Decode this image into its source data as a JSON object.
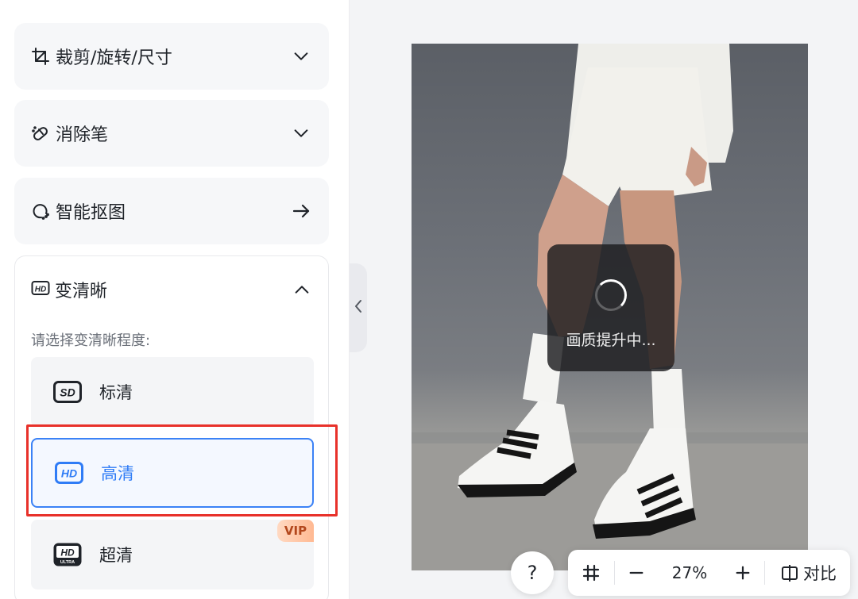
{
  "sidebar": {
    "crop": {
      "label": "裁剪/旋转/尺寸",
      "icon": "crop-icon",
      "action_icon": "chevron-down-icon"
    },
    "eraser": {
      "label": "消除笔",
      "icon": "eraser-icon",
      "action_icon": "chevron-down-icon"
    },
    "cutout": {
      "label": "智能抠图",
      "icon": "cutout-icon",
      "action_icon": "arrow-right-icon"
    },
    "enhance": {
      "label": "变清晰",
      "icon": "hd-icon",
      "action_icon": "chevron-up-icon",
      "prompt": "请选择变清晰程度:",
      "options": [
        {
          "label": "标清",
          "icon": "sd-badge-icon",
          "icon_text": "SD"
        },
        {
          "label": "高清",
          "icon": "hd-badge-icon",
          "icon_text": "HD",
          "selected": true
        },
        {
          "label": "超清",
          "icon": "uhd-badge-icon",
          "icon_text": "HD",
          "icon_subtext": "ULTRA",
          "badge": "VIP"
        }
      ]
    }
  },
  "canvas": {
    "loading_text": "画质提升中..."
  },
  "toolbar": {
    "help": "?",
    "zoom": "27%",
    "compare_label": "对比"
  },
  "colors": {
    "accent": "#2f7cf6",
    "highlight": "#e8312a",
    "vip": "#ffb992"
  }
}
